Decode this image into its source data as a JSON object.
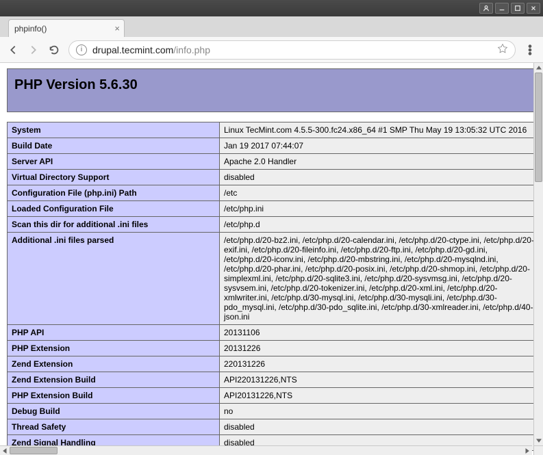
{
  "window": {
    "tab_title": "phpinfo()",
    "url_host": "drupal.tecmint.com",
    "url_path": "/info.php"
  },
  "page": {
    "heading": "PHP Version 5.6.30",
    "rows": [
      {
        "k": "System",
        "v": "Linux TecMint.com 4.5.5-300.fc24.x86_64 #1 SMP Thu May 19 13:05:32 UTC 2016"
      },
      {
        "k": "Build Date",
        "v": "Jan 19 2017 07:44:07"
      },
      {
        "k": "Server API",
        "v": "Apache 2.0 Handler"
      },
      {
        "k": "Virtual Directory Support",
        "v": "disabled"
      },
      {
        "k": "Configuration File (php.ini) Path",
        "v": "/etc"
      },
      {
        "k": "Loaded Configuration File",
        "v": "/etc/php.ini"
      },
      {
        "k": "Scan this dir for additional .ini files",
        "v": "/etc/php.d"
      },
      {
        "k": "Additional .ini files parsed",
        "v": "/etc/php.d/20-bz2.ini, /etc/php.d/20-calendar.ini, /etc/php.d/20-ctype.ini, /etc/php.d/20-exif.ini, /etc/php.d/20-fileinfo.ini, /etc/php.d/20-ftp.ini, /etc/php.d/20-gd.ini, /etc/php.d/20-iconv.ini, /etc/php.d/20-mbstring.ini, /etc/php.d/20-mysqlnd.ini, /etc/php.d/20-phar.ini, /etc/php.d/20-posix.ini, /etc/php.d/20-shmop.ini, /etc/php.d/20-simplexml.ini, /etc/php.d/20-sqlite3.ini, /etc/php.d/20-sysvmsg.ini, /etc/php.d/20-sysvsem.ini, /etc/php.d/20-tokenizer.ini, /etc/php.d/20-xml.ini, /etc/php.d/20-xmlwriter.ini, /etc/php.d/30-mysql.ini, /etc/php.d/30-mysqli.ini, /etc/php.d/30-pdo_mysql.ini, /etc/php.d/30-pdo_sqlite.ini, /etc/php.d/30-xmlreader.ini, /etc/php.d/40-json.ini"
      },
      {
        "k": "PHP API",
        "v": "20131106"
      },
      {
        "k": "PHP Extension",
        "v": "20131226"
      },
      {
        "k": "Zend Extension",
        "v": "220131226"
      },
      {
        "k": "Zend Extension Build",
        "v": "API220131226,NTS"
      },
      {
        "k": "PHP Extension Build",
        "v": "API20131226,NTS"
      },
      {
        "k": "Debug Build",
        "v": "no"
      },
      {
        "k": "Thread Safety",
        "v": "disabled"
      },
      {
        "k": "Zend Signal Handling",
        "v": "disabled"
      }
    ]
  }
}
